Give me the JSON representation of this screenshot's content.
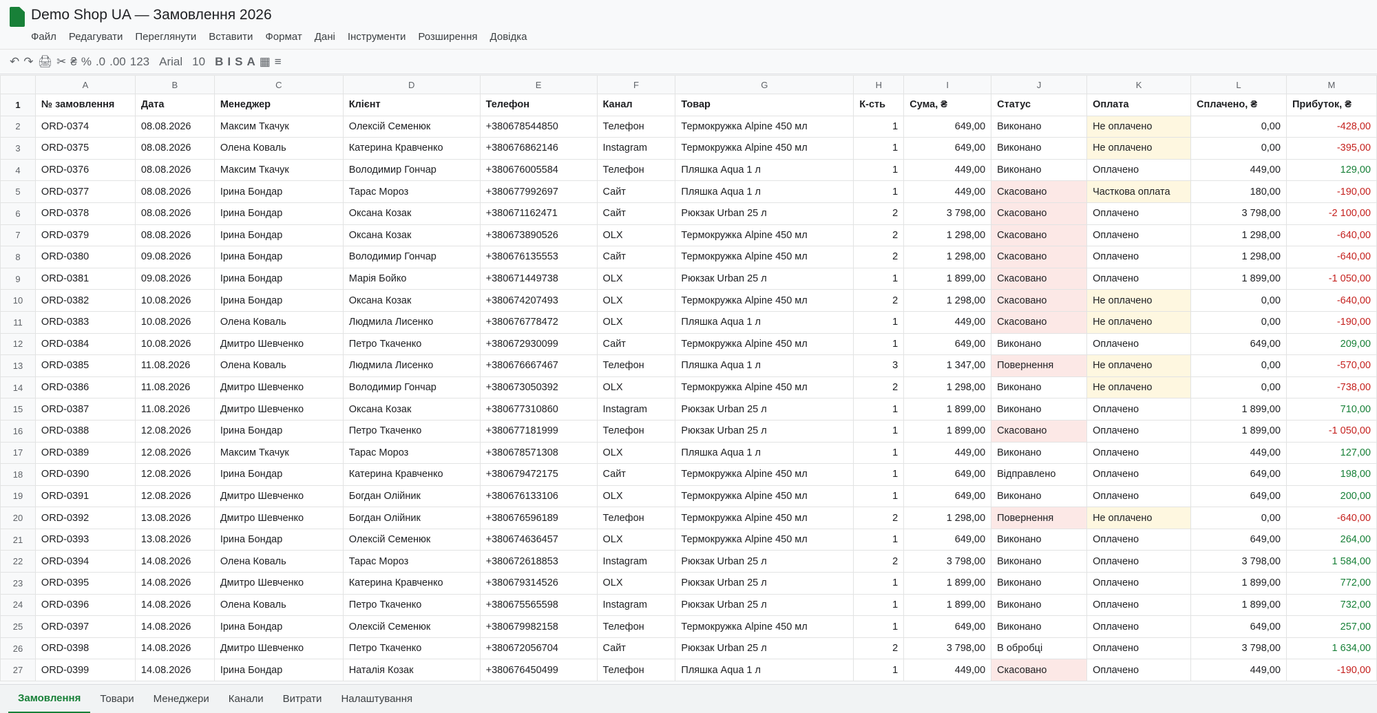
{
  "app": {
    "title": "Demo Shop UA — Замовлення 2026",
    "icon": "spreadsheet-icon"
  },
  "menu": [
    "Файл",
    "Редагувати",
    "Переглянути",
    "Вставити",
    "Формат",
    "Дані",
    "Інструменти",
    "Розширення",
    "Довідка"
  ],
  "toolbar": {
    "undo": "↶",
    "redo": "↷",
    "print": "🖨",
    "paint": "✂",
    "currency": "₴",
    "percent": "%",
    "dec_less": ".0",
    "dec_more": ".00",
    "num_format": "123",
    "font": "Arial",
    "font_size": "10",
    "bold": "B",
    "italic": "I",
    "strike": "S",
    "text_color": "A",
    "fill": "▦",
    "align": "≡"
  },
  "columns": [
    "A",
    "B",
    "C",
    "D",
    "E",
    "F",
    "G",
    "H",
    "I",
    "J",
    "K",
    "L",
    "M"
  ],
  "headers": [
    "№ замовлення",
    "Дата",
    "Менеджер",
    "Клієнт",
    "Телефон",
    "Канал",
    "Товар",
    "К-сть",
    "Сума, ₴",
    "Статус",
    "Оплата",
    "Сплачено, ₴",
    "Прибуток, ₴"
  ],
  "rows": [
    [
      "ORD-0374",
      "08.08.2026",
      "Максим Ткачук",
      "Олексій Семенюк",
      "+380678544850",
      "Телефон",
      "Термокружка Alpine 450 мл",
      "1",
      "649,00",
      "Виконано",
      "Не оплачено",
      "0,00",
      "-428,00"
    ],
    [
      "ORD-0375",
      "08.08.2026",
      "Олена Коваль",
      "Катерина Кравченко",
      "+380676862146",
      "Instagram",
      "Термокружка Alpine 450 мл",
      "1",
      "649,00",
      "Виконано",
      "Не оплачено",
      "0,00",
      "-395,00"
    ],
    [
      "ORD-0376",
      "08.08.2026",
      "Максим Ткачук",
      "Володимир Гончар",
      "+380676005584",
      "Телефон",
      "Пляшка Aqua 1 л",
      "1",
      "449,00",
      "Виконано",
      "Оплачено",
      "449,00",
      "129,00"
    ],
    [
      "ORD-0377",
      "08.08.2026",
      "Ірина Бондар",
      "Тарас Мороз",
      "+380677992697",
      "Сайт",
      "Пляшка Aqua 1 л",
      "1",
      "449,00",
      "Скасовано",
      "Часткова оплата",
      "180,00",
      "-190,00"
    ],
    [
      "ORD-0378",
      "08.08.2026",
      "Ірина Бондар",
      "Оксана Козак",
      "+380671162471",
      "Сайт",
      "Рюкзак Urban 25 л",
      "2",
      "3 798,00",
      "Скасовано",
      "Оплачено",
      "3 798,00",
      "-2 100,00"
    ],
    [
      "ORD-0379",
      "08.08.2026",
      "Ірина Бондар",
      "Оксана Козак",
      "+380673890526",
      "OLX",
      "Термокружка Alpine 450 мл",
      "2",
      "1 298,00",
      "Скасовано",
      "Оплачено",
      "1 298,00",
      "-640,00"
    ],
    [
      "ORD-0380",
      "09.08.2026",
      "Ірина Бондар",
      "Володимир Гончар",
      "+380676135553",
      "Сайт",
      "Термокружка Alpine 450 мл",
      "2",
      "1 298,00",
      "Скасовано",
      "Оплачено",
      "1 298,00",
      "-640,00"
    ],
    [
      "ORD-0381",
      "09.08.2026",
      "Ірина Бондар",
      "Марія Бойко",
      "+380671449738",
      "OLX",
      "Рюкзак Urban 25 л",
      "1",
      "1 899,00",
      "Скасовано",
      "Оплачено",
      "1 899,00",
      "-1 050,00"
    ],
    [
      "ORD-0382",
      "10.08.2026",
      "Ірина Бондар",
      "Оксана Козак",
      "+380674207493",
      "OLX",
      "Термокружка Alpine 450 мл",
      "2",
      "1 298,00",
      "Скасовано",
      "Не оплачено",
      "0,00",
      "-640,00"
    ],
    [
      "ORD-0383",
      "10.08.2026",
      "Олена Коваль",
      "Людмила Лисенко",
      "+380676778472",
      "OLX",
      "Пляшка Aqua 1 л",
      "1",
      "449,00",
      "Скасовано",
      "Не оплачено",
      "0,00",
      "-190,00"
    ],
    [
      "ORD-0384",
      "10.08.2026",
      "Дмитро Шевченко",
      "Петро Ткаченко",
      "+380672930099",
      "Сайт",
      "Термокружка Alpine 450 мл",
      "1",
      "649,00",
      "Виконано",
      "Оплачено",
      "649,00",
      "209,00"
    ],
    [
      "ORD-0385",
      "11.08.2026",
      "Олена Коваль",
      "Людмила Лисенко",
      "+380676667467",
      "Телефон",
      "Пляшка Aqua 1 л",
      "3",
      "1 347,00",
      "Повернення",
      "Не оплачено",
      "0,00",
      "-570,00"
    ],
    [
      "ORD-0386",
      "11.08.2026",
      "Дмитро Шевченко",
      "Володимир Гончар",
      "+380673050392",
      "OLX",
      "Термокружка Alpine 450 мл",
      "2",
      "1 298,00",
      "Виконано",
      "Не оплачено",
      "0,00",
      "-738,00"
    ],
    [
      "ORD-0387",
      "11.08.2026",
      "Дмитро Шевченко",
      "Оксана Козак",
      "+380677310860",
      "Instagram",
      "Рюкзак Urban 25 л",
      "1",
      "1 899,00",
      "Виконано",
      "Оплачено",
      "1 899,00",
      "710,00"
    ],
    [
      "ORD-0388",
      "12.08.2026",
      "Ірина Бондар",
      "Петро Ткаченко",
      "+380677181999",
      "Телефон",
      "Рюкзак Urban 25 л",
      "1",
      "1 899,00",
      "Скасовано",
      "Оплачено",
      "1 899,00",
      "-1 050,00"
    ],
    [
      "ORD-0389",
      "12.08.2026",
      "Максим Ткачук",
      "Тарас Мороз",
      "+380678571308",
      "OLX",
      "Пляшка Aqua 1 л",
      "1",
      "449,00",
      "Виконано",
      "Оплачено",
      "449,00",
      "127,00"
    ],
    [
      "ORD-0390",
      "12.08.2026",
      "Ірина Бондар",
      "Катерина Кравченко",
      "+380679472175",
      "Сайт",
      "Термокружка Alpine 450 мл",
      "1",
      "649,00",
      "Відправлено",
      "Оплачено",
      "649,00",
      "198,00"
    ],
    [
      "ORD-0391",
      "12.08.2026",
      "Дмитро Шевченко",
      "Богдан Олійник",
      "+380676133106",
      "OLX",
      "Термокружка Alpine 450 мл",
      "1",
      "649,00",
      "Виконано",
      "Оплачено",
      "649,00",
      "200,00"
    ],
    [
      "ORD-0392",
      "13.08.2026",
      "Дмитро Шевченко",
      "Богдан Олійник",
      "+380676596189",
      "Телефон",
      "Термокружка Alpine 450 мл",
      "2",
      "1 298,00",
      "Повернення",
      "Не оплачено",
      "0,00",
      "-640,00"
    ],
    [
      "ORD-0393",
      "13.08.2026",
      "Ірина Бондар",
      "Олексій Семенюк",
      "+380674636457",
      "OLX",
      "Термокружка Alpine 450 мл",
      "1",
      "649,00",
      "Виконано",
      "Оплачено",
      "649,00",
      "264,00"
    ],
    [
      "ORD-0394",
      "14.08.2026",
      "Олена Коваль",
      "Тарас Мороз",
      "+380672618853",
      "Instagram",
      "Рюкзак Urban 25 л",
      "2",
      "3 798,00",
      "Виконано",
      "Оплачено",
      "3 798,00",
      "1 584,00"
    ],
    [
      "ORD-0395",
      "14.08.2026",
      "Дмитро Шевченко",
      "Катерина Кравченко",
      "+380679314526",
      "OLX",
      "Рюкзак Urban 25 л",
      "1",
      "1 899,00",
      "Виконано",
      "Оплачено",
      "1 899,00",
      "772,00"
    ],
    [
      "ORD-0396",
      "14.08.2026",
      "Олена Коваль",
      "Петро Ткаченко",
      "+380675565598",
      "Instagram",
      "Рюкзак Urban 25 л",
      "1",
      "1 899,00",
      "Виконано",
      "Оплачено",
      "1 899,00",
      "732,00"
    ],
    [
      "ORD-0397",
      "14.08.2026",
      "Ірина Бондар",
      "Олексій Семенюк",
      "+380679982158",
      "Телефон",
      "Термокружка Alpine 450 мл",
      "1",
      "649,00",
      "Виконано",
      "Оплачено",
      "649,00",
      "257,00"
    ],
    [
      "ORD-0398",
      "14.08.2026",
      "Дмитро Шевченко",
      "Петро Ткаченко",
      "+380672056704",
      "Сайт",
      "Рюкзак Urban 25 л",
      "2",
      "3 798,00",
      "В обробці",
      "Оплачено",
      "3 798,00",
      "1 634,00"
    ],
    [
      "ORD-0399",
      "14.08.2026",
      "Ірина Бондар",
      "Наталія Козак",
      "+380676450499",
      "Телефон",
      "Пляшка Aqua 1 л",
      "1",
      "449,00",
      "Скасовано",
      "Оплачено",
      "449,00",
      "-190,00"
    ]
  ],
  "sheets": [
    "Замовлення",
    "Товари",
    "Менеджери",
    "Канали",
    "Витрати",
    "Налаштування"
  ],
  "active_sheet": "Замовлення",
  "colors": {
    "accent": "#188038",
    "negative": "#c5221f",
    "status_bad_fill": "#fce8e6",
    "payment_warn_fill": "#fef7e0"
  }
}
